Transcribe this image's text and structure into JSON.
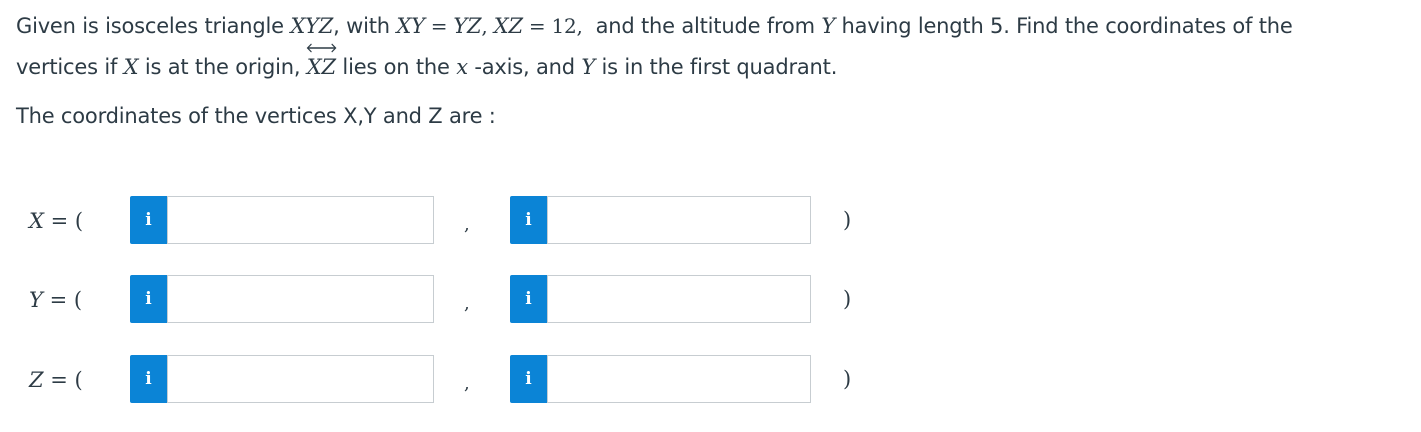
{
  "question": {
    "line1": {
      "t1": "Given is isosceles triangle ",
      "m1": "XYZ",
      "t2": ", with ",
      "m2": "XY",
      "eq1": "=",
      "m3": "YZ",
      "c1": ", ",
      "m4": "XZ",
      "eq2": "=",
      "n1": "12,",
      "t3": "  and the altitude from ",
      "m5": "Y",
      "t4": " having length 5. Find the coordinates of the"
    },
    "line2": {
      "t1": "vertices if ",
      "m1": "X",
      "t2": " is at the origin, ",
      "m2": "XZ",
      "t3": " lies on the ",
      "m3": "x",
      "t4": " -axis, and ",
      "m4": "Y",
      "t5": " is in the first quadrant."
    },
    "line3": "The coordinates of the vertices X,Y and Z are :"
  },
  "rows": [
    {
      "var": "X",
      "eq": "= (",
      "comma": ",",
      "close": ")",
      "info": "i",
      "value1": "",
      "value2": ""
    },
    {
      "var": "Y",
      "eq": "= (",
      "comma": ",",
      "close": ")",
      "info": "i",
      "value1": "",
      "value2": ""
    },
    {
      "var": "Z",
      "eq": "= (",
      "comma": ",",
      "close": ")",
      "info": "i",
      "value1": "",
      "value2": ""
    }
  ],
  "colors": {
    "text": "#2d3b45",
    "info_button": "#0b84d6",
    "input_border": "#c7cdd1"
  },
  "icons": {
    "info": "info-icon",
    "overarrow": "double-headed-arrow-icon"
  }
}
